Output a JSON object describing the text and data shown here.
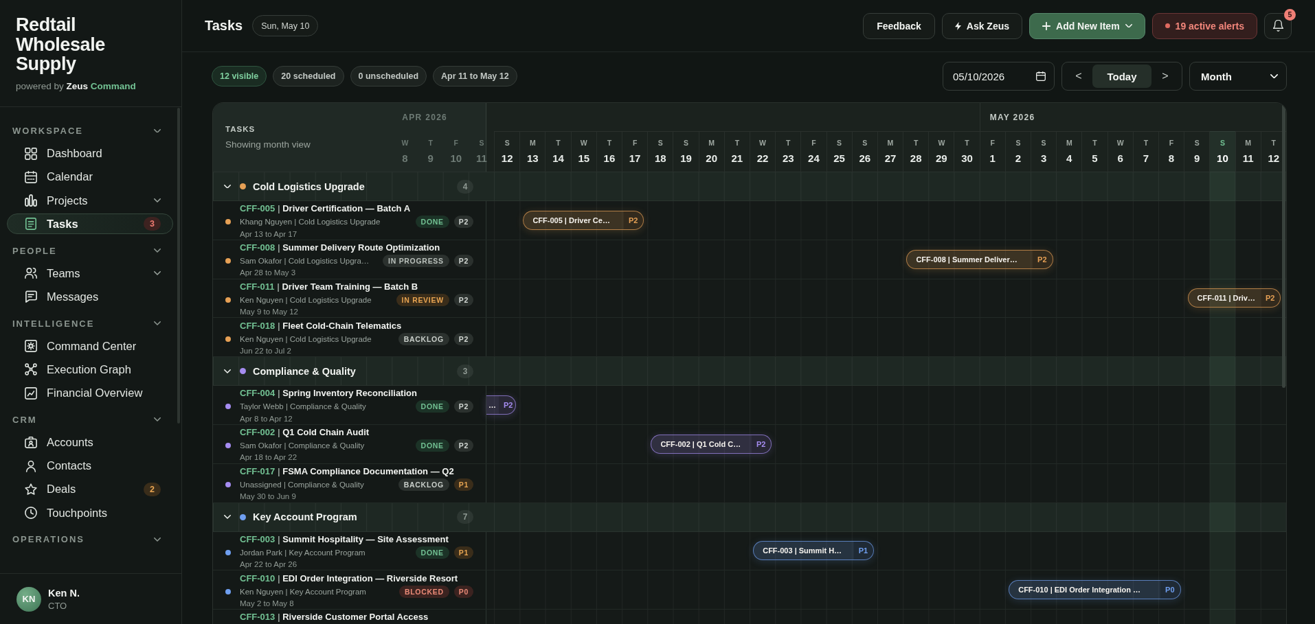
{
  "sidebar": {
    "brand": {
      "name": "Redtail Wholesale Supply",
      "powered_by": "powered by",
      "product": "Zeus",
      "product_accent": "Command"
    },
    "sections": [
      {
        "label": "WORKSPACE",
        "expanded": true,
        "items": [
          {
            "label": "Dashboard",
            "kind": "dashboard",
            "selected": false,
            "submenu": false
          },
          {
            "label": "Calendar",
            "kind": "calendar",
            "selected": false,
            "submenu": false
          },
          {
            "label": "Projects",
            "kind": "projects",
            "selected": false,
            "submenu": true
          },
          {
            "label": "Tasks",
            "kind": "tasks",
            "selected": true,
            "submenu": false,
            "badge": {
              "text": "3",
              "kind": "danger"
            }
          }
        ]
      },
      {
        "label": "PEOPLE",
        "expanded": true,
        "items": [
          {
            "label": "Teams",
            "kind": "teams",
            "selected": false,
            "submenu": true
          },
          {
            "label": "Messages",
            "kind": "messages",
            "selected": false,
            "submenu": false
          }
        ]
      },
      {
        "label": "INTELLIGENCE",
        "expanded": true,
        "items": [
          {
            "label": "Command Center",
            "kind": "command",
            "selected": false,
            "submenu": false
          },
          {
            "label": "Execution Graph",
            "kind": "graph",
            "selected": false,
            "submenu": false
          },
          {
            "label": "Financial Overview",
            "kind": "financial",
            "selected": false,
            "submenu": false
          }
        ]
      },
      {
        "label": "CRM",
        "expanded": true,
        "items": [
          {
            "label": "Accounts",
            "kind": "accounts",
            "selected": false,
            "submenu": false
          },
          {
            "label": "Contacts",
            "kind": "contacts",
            "selected": false,
            "submenu": false
          },
          {
            "label": "Deals",
            "kind": "deals",
            "selected": false,
            "submenu": false,
            "badge": {
              "text": "2",
              "kind": "warning"
            }
          },
          {
            "label": "Touchpoints",
            "kind": "touchpoints",
            "selected": false,
            "submenu": false
          }
        ]
      },
      {
        "label": "OPERATIONS",
        "expanded": true
      }
    ],
    "user": {
      "initials": "KN",
      "name": "Ken N.",
      "role": "CTO"
    }
  },
  "header": {
    "title": "Tasks",
    "date": "Sun, May 10",
    "actions": [
      {
        "label": "Feedback",
        "kind": "plain"
      },
      {
        "label": "Ask Zeus",
        "kind": "assistant"
      },
      {
        "label": "Add New Item",
        "kind": "create"
      }
    ],
    "alerts": "19 active alerts",
    "notifications_badge": "5"
  },
  "toolbar": {
    "chips": [
      {
        "label": "12 visible",
        "kind": "accent"
      },
      {
        "label": "20 scheduled",
        "kind": "neutral"
      },
      {
        "label": "0 unscheduled",
        "kind": "neutral"
      },
      {
        "label": "Apr 11 to May 12",
        "kind": "neutral"
      }
    ],
    "date_value": "05/10/2026",
    "previous": "<",
    "today": "Today",
    "next": ">",
    "view": "Month"
  },
  "gantt": {
    "title": "TASKS",
    "subtitle": "Showing month view",
    "months": [
      {
        "label": "APR 2026",
        "days": [
          {
            "weekday": "W",
            "date": "8",
            "today": false
          },
          {
            "weekday": "T",
            "date": "9",
            "today": false
          },
          {
            "weekday": "F",
            "date": "10",
            "today": false
          },
          {
            "weekday": "S",
            "date": "11",
            "today": false
          },
          {
            "weekday": "S",
            "date": "12",
            "today": false
          },
          {
            "weekday": "M",
            "date": "13",
            "today": false
          },
          {
            "weekday": "T",
            "date": "14",
            "today": false
          },
          {
            "weekday": "W",
            "date": "15",
            "today": false
          },
          {
            "weekday": "T",
            "date": "16",
            "today": false
          },
          {
            "weekday": "F",
            "date": "17",
            "today": false
          },
          {
            "weekday": "S",
            "date": "18",
            "today": false
          },
          {
            "weekday": "S",
            "date": "19",
            "today": false
          },
          {
            "weekday": "M",
            "date": "20",
            "today": false
          },
          {
            "weekday": "T",
            "date": "21",
            "today": false
          },
          {
            "weekday": "W",
            "date": "22",
            "today": false
          },
          {
            "weekday": "T",
            "date": "23",
            "today": false
          },
          {
            "weekday": "F",
            "date": "24",
            "today": false
          },
          {
            "weekday": "S",
            "date": "25",
            "today": false
          },
          {
            "weekday": "S",
            "date": "26",
            "today": false
          },
          {
            "weekday": "M",
            "date": "27",
            "today": false
          },
          {
            "weekday": "T",
            "date": "28",
            "today": false
          },
          {
            "weekday": "W",
            "date": "29",
            "today": false
          },
          {
            "weekday": "T",
            "date": "30",
            "today": false
          }
        ]
      },
      {
        "label": "MAY 2026",
        "days": [
          {
            "weekday": "F",
            "date": "1",
            "today": false
          },
          {
            "weekday": "S",
            "date": "2",
            "today": false
          },
          {
            "weekday": "S",
            "date": "3",
            "today": false
          },
          {
            "weekday": "M",
            "date": "4",
            "today": false
          },
          {
            "weekday": "T",
            "date": "5",
            "today": false
          },
          {
            "weekday": "W",
            "date": "6",
            "today": false
          },
          {
            "weekday": "T",
            "date": "7",
            "today": false
          },
          {
            "weekday": "F",
            "date": "8",
            "today": false
          },
          {
            "weekday": "S",
            "date": "9",
            "today": false
          },
          {
            "weekday": "S",
            "date": "10",
            "today": true
          },
          {
            "weekday": "M",
            "date": "11",
            "today": false
          },
          {
            "weekday": "T",
            "date": "12",
            "today": false
          }
        ]
      }
    ],
    "groups": [
      {
        "name": "Cold Logistics Upgrade",
        "color": "#e6a055",
        "count": "4",
        "expanded": true,
        "tasks": [
          {
            "code": "CFF-005",
            "separator": "|",
            "title": "Driver Certification — Batch A",
            "meta": "Khang Nguyen | Cold Logistics Upgrade",
            "dates": "Apr 13 to Apr 17",
            "status": {
              "label": "DONE",
              "kind": "done"
            },
            "priority": {
              "label": "P2",
              "kind": "medium"
            },
            "bar": {
              "label": "CFF-005 | Driver Ce…",
              "priority": "P2"
            }
          },
          {
            "code": "CFF-008",
            "separator": "|",
            "title": "Summer Delivery Route Optimization",
            "meta": "Sam Okafor | Cold Logistics Upgra…",
            "dates": "Apr 28 to May 3",
            "status": {
              "label": "IN PROGRESS",
              "kind": "progress"
            },
            "priority": {
              "label": "P2",
              "kind": "medium"
            },
            "bar": {
              "label": "CFF-008 | Summer Deliver…",
              "priority": "P2"
            }
          },
          {
            "code": "CFF-011",
            "separator": "|",
            "title": "Driver Team Training — Batch B",
            "meta": "Ken Nguyen | Cold Logistics Upgrade",
            "dates": "May 9 to May 12",
            "status": {
              "label": "IN REVIEW",
              "kind": "review"
            },
            "priority": {
              "label": "P2",
              "kind": "medium"
            },
            "bar": {
              "label": "CFF-011 | Driv…",
              "priority": "P2"
            }
          },
          {
            "code": "CFF-018",
            "separator": "|",
            "title": "Fleet Cold-Chain Telematics",
            "meta": "Ken Nguyen | Cold Logistics Upgrade",
            "dates": "Jun 22 to Jul 2",
            "status": {
              "label": "BACKLOG",
              "kind": "backlog"
            },
            "priority": {
              "label": "P2",
              "kind": "medium"
            }
          }
        ]
      },
      {
        "name": "Compliance & Quality",
        "color": "#a58cf0",
        "count": "3",
        "expanded": true,
        "tasks": [
          {
            "code": "CFF-004",
            "separator": "|",
            "title": "Spring Inventory Reconciliation",
            "meta": "Taylor Webb | Compliance & Quality",
            "dates": "Apr 8 to Apr 12",
            "status": {
              "label": "DONE",
              "kind": "done"
            },
            "priority": {
              "label": "P2",
              "kind": "medium"
            },
            "bar": {
              "label": "…",
              "priority": "P2"
            }
          },
          {
            "code": "CFF-002",
            "separator": "|",
            "title": "Q1 Cold Chain Audit",
            "meta": "Sam Okafor | Compliance & Quality",
            "dates": "Apr 18 to Apr 22",
            "status": {
              "label": "DONE",
              "kind": "done"
            },
            "priority": {
              "label": "P2",
              "kind": "medium"
            },
            "bar": {
              "label": "CFF-002 | Q1 Cold C…",
              "priority": "P2"
            }
          },
          {
            "code": "CFF-017",
            "separator": "|",
            "title": "FSMA Compliance Documentation — Q2",
            "meta": "Unassigned | Compliance & Quality",
            "dates": "May 30 to Jun 9",
            "status": {
              "label": "BACKLOG",
              "kind": "backlog"
            },
            "priority": {
              "label": "P1",
              "kind": "high"
            }
          }
        ]
      },
      {
        "name": "Key Account Program",
        "color": "#6f9ff0",
        "count": "7",
        "expanded": true,
        "tasks": [
          {
            "code": "CFF-003",
            "separator": "|",
            "title": "Summit Hospitality — Site Assessment",
            "meta": "Jordan Park | Key Account Program",
            "dates": "Apr 22 to Apr 26",
            "status": {
              "label": "DONE",
              "kind": "done"
            },
            "priority": {
              "label": "P1",
              "kind": "high"
            },
            "bar": {
              "label": "CFF-003 | Summit H…",
              "priority": "P1"
            }
          },
          {
            "code": "CFF-010",
            "separator": "|",
            "title": "EDI Order Integration — Riverside Resort",
            "meta": "Ken Nguyen | Key Account Program",
            "dates": "May 2 to May 8",
            "status": {
              "label": "BLOCKED",
              "kind": "blocked"
            },
            "priority": {
              "label": "P0",
              "kind": "critical"
            },
            "bar": {
              "label": "CFF-010 | EDI Order Integration …",
              "priority": "P0"
            }
          },
          {
            "code": "CFF-013",
            "separator": "|",
            "title": "Riverside Customer Portal Access"
          }
        ]
      }
    ]
  }
}
